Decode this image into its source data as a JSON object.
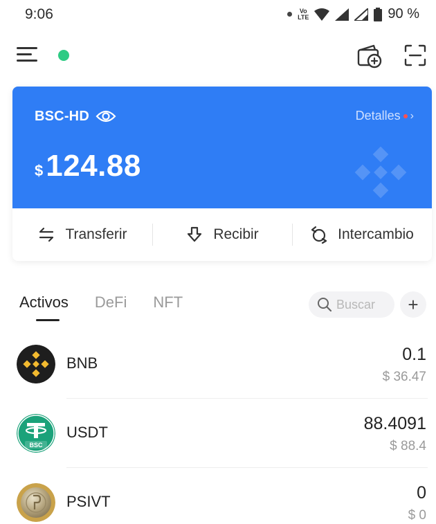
{
  "status_bar": {
    "time": "9:06",
    "network_badge_top": "Vo",
    "network_badge_bottom": "LTE",
    "battery": "90 %"
  },
  "topbar": {
    "menu_icon": "menu-icon",
    "status_color": "#2ecb84"
  },
  "wallet_card": {
    "name": "BSC-HD",
    "details_label": "Detalles",
    "currency_symbol": "$",
    "balance": "124.88",
    "card_color": "#2f7df5"
  },
  "actions": [
    {
      "label": "Transferir",
      "icon": "transfer-arrows-icon"
    },
    {
      "label": "Recibir",
      "icon": "receive-arrow-icon"
    },
    {
      "label": "Intercambio",
      "icon": "swap-icon"
    }
  ],
  "tabs": [
    {
      "label": "Activos",
      "active": true
    },
    {
      "label": "DeFi",
      "active": false
    },
    {
      "label": "NFT",
      "active": false
    }
  ],
  "search": {
    "placeholder": "Buscar"
  },
  "assets": [
    {
      "symbol": "BNB",
      "amount": "0.1",
      "value": "$ 36.47",
      "icon": "bnb-logo-icon"
    },
    {
      "symbol": "USDT",
      "amount": "88.4091",
      "value": "$ 88.4",
      "icon": "usdt-bsc-logo-icon",
      "badge": "BSC"
    },
    {
      "symbol": "PSIVT",
      "amount": "0",
      "value": "$ 0",
      "icon": "psivt-coin-icon"
    }
  ]
}
